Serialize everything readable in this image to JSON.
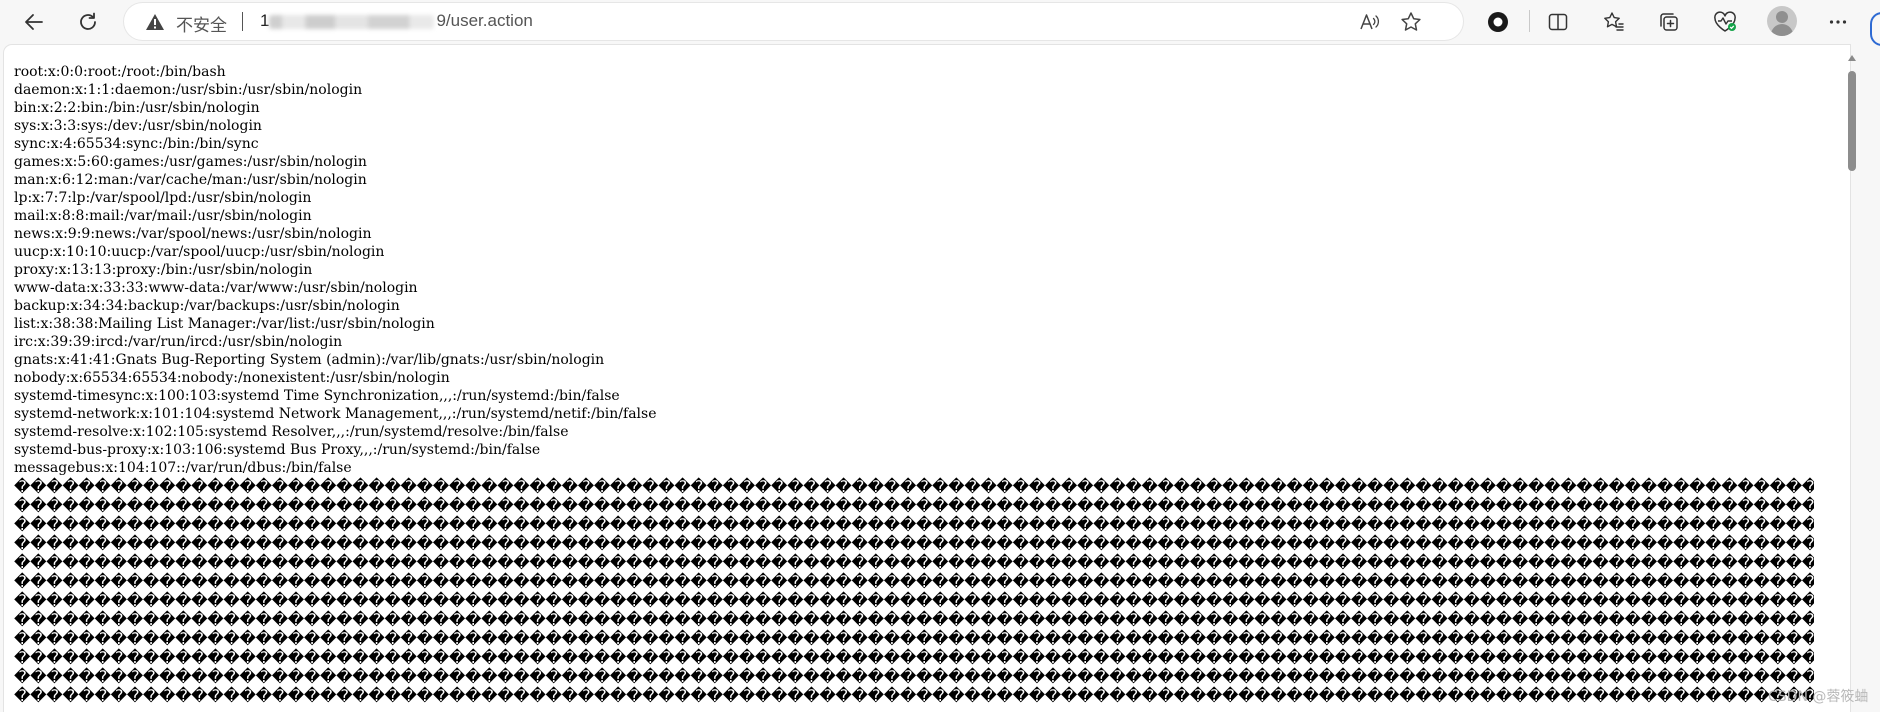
{
  "browser": {
    "back_icon": "arrow-left-icon",
    "refresh_icon": "refresh-icon",
    "security_label": "不安全",
    "url_visible_start": "1",
    "url_visible_end": "9/user.action",
    "read_aloud_icon": "read-aloud-icon",
    "favorite_icon": "star-icon",
    "toolbar_icons": [
      "record-icon",
      "split-screen-icon",
      "favorites-list-icon",
      "collections-icon",
      "browser-essentials-icon",
      "profile-avatar-icon",
      "more-icon"
    ]
  },
  "page": {
    "lines": [
      "root:x:0:0:root:/root:/bin/bash",
      "daemon:x:1:1:daemon:/usr/sbin:/usr/sbin/nologin",
      "bin:x:2:2:bin:/bin:/usr/sbin/nologin",
      "sys:x:3:3:sys:/dev:/usr/sbin/nologin",
      "sync:x:4:65534:sync:/bin:/bin/sync",
      "games:x:5:60:games:/usr/games:/usr/sbin/nologin",
      "man:x:6:12:man:/var/cache/man:/usr/sbin/nologin",
      "lp:x:7:7:lp:/var/spool/lpd:/usr/sbin/nologin",
      "mail:x:8:8:mail:/var/mail:/usr/sbin/nologin",
      "news:x:9:9:news:/var/spool/news:/usr/sbin/nologin",
      "uucp:x:10:10:uucp:/var/spool/uucp:/usr/sbin/nologin",
      "proxy:x:13:13:proxy:/bin:/usr/sbin/nologin",
      "www-data:x:33:33:www-data:/var/www:/usr/sbin/nologin",
      "backup:x:34:34:backup:/var/backups:/usr/sbin/nologin",
      "list:x:38:38:Mailing List Manager:/var/list:/usr/sbin/nologin",
      "irc:x:39:39:ircd:/var/run/ircd:/usr/sbin/nologin",
      "gnats:x:41:41:Gnats Bug-Reporting System (admin):/var/lib/gnats:/usr/sbin/nologin",
      "nobody:x:65534:65534:nobody:/nonexistent:/usr/sbin/nologin",
      "systemd-timesync:x:100:103:systemd Time Synchronization,,,:/run/systemd:/bin/false",
      "systemd-network:x:101:104:systemd Network Management,,,:/run/systemd/netif:/bin/false",
      "systemd-resolve:x:102:105:systemd Resolver,,,:/run/systemd/resolve:/bin/false",
      "systemd-bus-proxy:x:103:106:systemd Bus Proxy,,,:/run/systemd:/bin/false",
      "messagebus:x:104:107::/var/run/dbus:/bin/false"
    ],
    "garbage_char": "�",
    "garbage_line_count": 12,
    "garbage_chars_per_line": 116
  },
  "watermark": "CSDN @蓉筱蛐"
}
